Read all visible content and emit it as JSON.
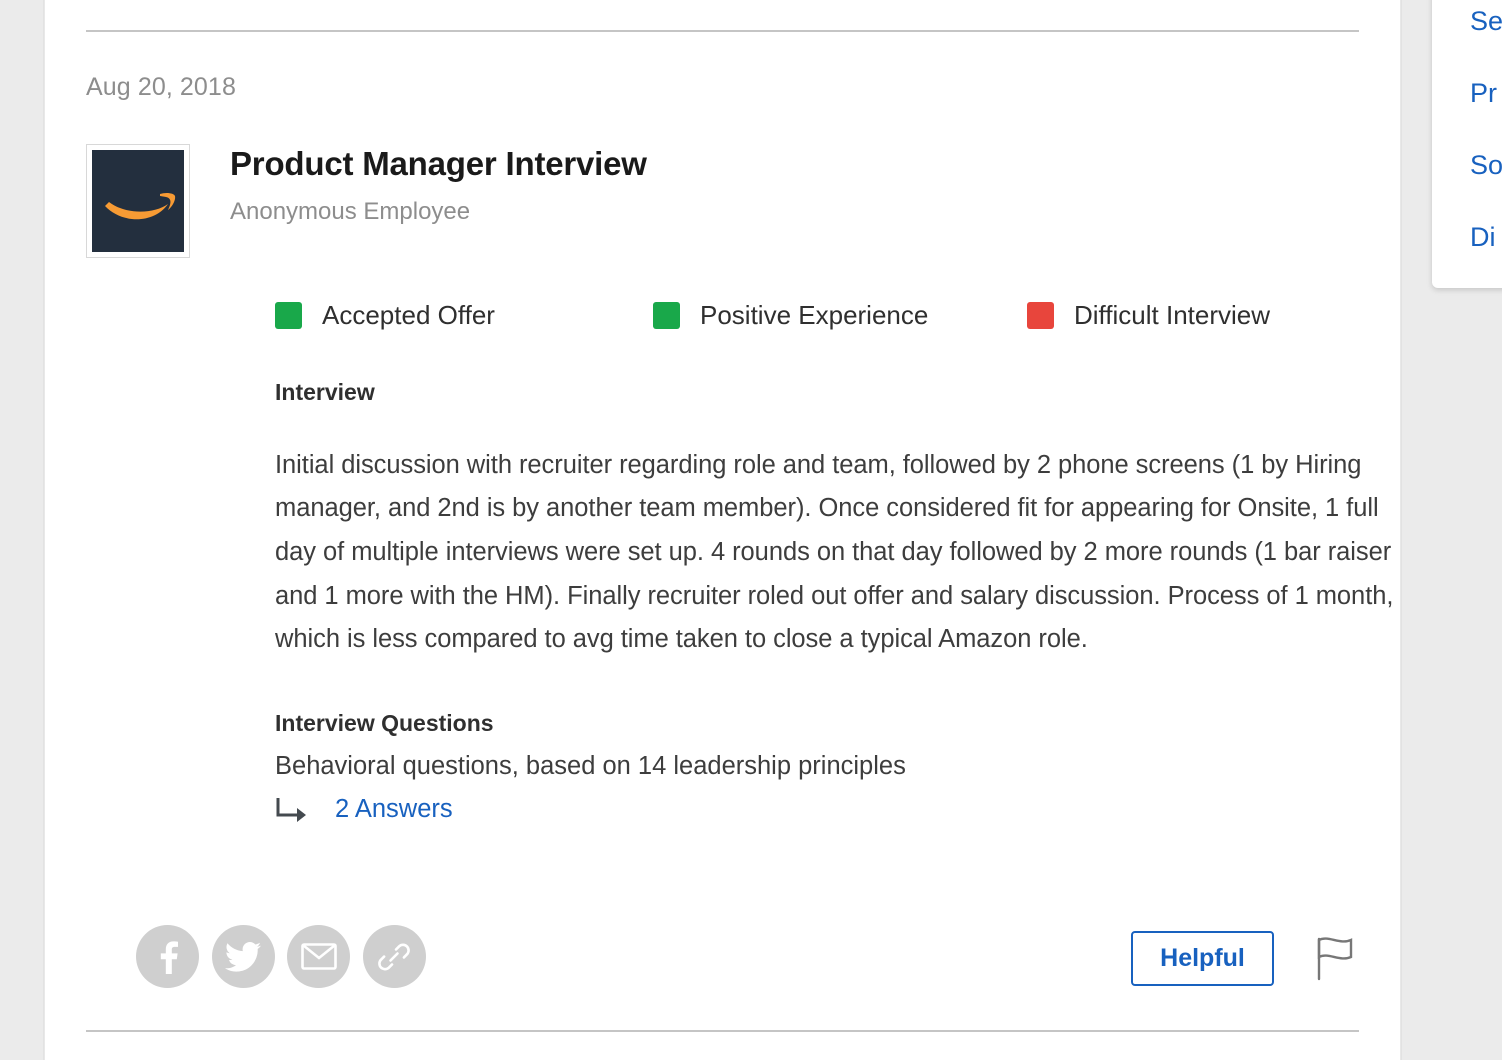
{
  "review": {
    "date": "Aug 20, 2018",
    "title": "Product Manager Interview",
    "reviewer": "Anonymous Employee",
    "employer_logo_alt": "amazon-logo",
    "statuses": [
      {
        "label": "Accepted Offer",
        "color": "#19a84a"
      },
      {
        "label": "Positive Experience",
        "color": "#19a84a"
      },
      {
        "label": "Difficult Interview",
        "color": "#e8453c"
      }
    ],
    "interview_heading": "Interview",
    "interview_text": "Initial discussion with recruiter regarding role and team, followed by 2 phone screens (1 by Hiring manager, and 2nd is by another team member). Once considered fit for appearing for Onsite, 1 full day of multiple interviews were set up. 4 rounds on that day followed by 2 more rounds (1 bar raiser and 1 more with the HM). Finally recruiter roled out offer and salary discussion. Process of 1 month, which is less compared to avg time taken to close a typical Amazon role.",
    "questions_heading": "Interview Questions",
    "questions_text": "Behavioral questions, based on 14 leadership principles",
    "answers_link": "2 Answers"
  },
  "footer": {
    "share": [
      {
        "name": "facebook-icon",
        "label": "Facebook"
      },
      {
        "name": "twitter-icon",
        "label": "Twitter"
      },
      {
        "name": "email-icon",
        "label": "Email"
      },
      {
        "name": "link-icon",
        "label": "Copy link"
      }
    ],
    "helpful_label": "Helpful",
    "flag_label": "Flag"
  },
  "right_rail": {
    "links": [
      {
        "label": "Se"
      },
      {
        "label": "Pr"
      },
      {
        "label": "So"
      },
      {
        "label": "Di"
      }
    ]
  },
  "theme": {
    "link_blue": "#1861bf",
    "green": "#19a84a",
    "red": "#e8453c",
    "logo_navy": "#232f3e",
    "logo_orange": "#f79b34"
  }
}
